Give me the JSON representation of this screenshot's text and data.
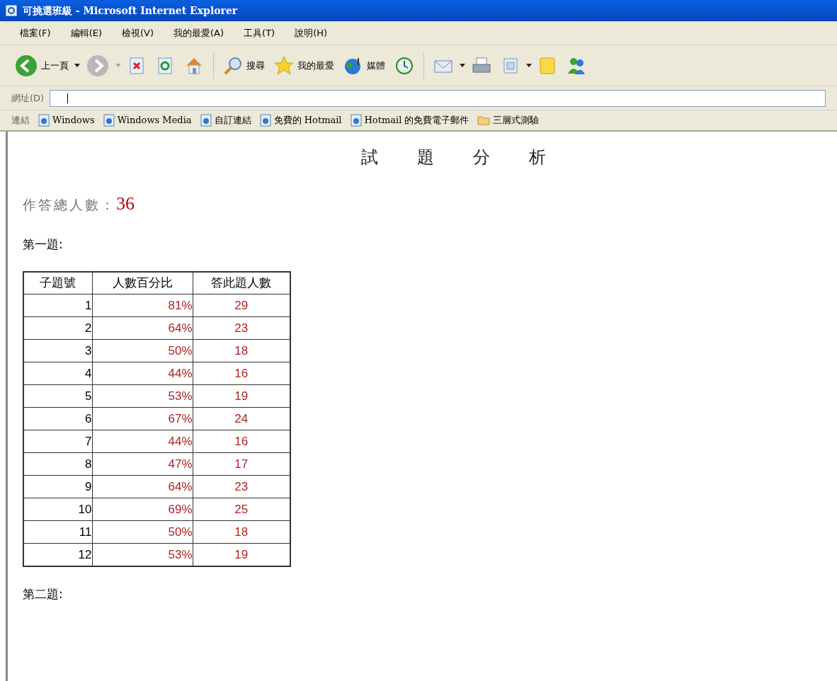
{
  "window": {
    "title": "可挑選班級 - Microsoft Internet Explorer"
  },
  "menu": [
    "檔案(F)",
    "編輯(E)",
    "檢視(V)",
    "我的最愛(A)",
    "工具(T)",
    "說明(H)"
  ],
  "toolbar": [
    {
      "kind": "back",
      "label": "上一頁",
      "dropdown": true,
      "disabled": false
    },
    {
      "kind": "forward",
      "dropdown": true,
      "disabled": true
    },
    {
      "kind": "stop"
    },
    {
      "kind": "refresh"
    },
    {
      "kind": "home"
    },
    {
      "kind": "separator"
    },
    {
      "kind": "search",
      "label": "搜尋"
    },
    {
      "kind": "favorites",
      "label": "我的最愛"
    },
    {
      "kind": "media",
      "label": "媒體"
    },
    {
      "kind": "history"
    },
    {
      "kind": "separator"
    },
    {
      "kind": "mail",
      "dropdown": true
    },
    {
      "kind": "print"
    },
    {
      "kind": "edit",
      "dropdown": true
    },
    {
      "kind": "note"
    },
    {
      "kind": "messenger"
    }
  ],
  "address": {
    "label": "網址(D)"
  },
  "links": {
    "label": "連結",
    "items": [
      {
        "kind": "page",
        "label": "Windows"
      },
      {
        "kind": "page",
        "label": "Windows Media"
      },
      {
        "kind": "page",
        "label": "自訂連結"
      },
      {
        "kind": "page",
        "label": "免費的 Hotmail"
      },
      {
        "kind": "page",
        "label": "Hotmail 的免費電子郵件"
      },
      {
        "kind": "folder",
        "label": "三層式測驗"
      }
    ]
  },
  "page": {
    "heading": "試題分析",
    "total_label": "作答總人數：",
    "total_value": "36",
    "sections": [
      {
        "title": "第一題:",
        "table": {
          "columns": [
            "子題號",
            "人數百分比",
            "答此題人數"
          ],
          "rows": [
            [
              "1",
              "81%",
              "29"
            ],
            [
              "2",
              "64%",
              "23"
            ],
            [
              "3",
              "50%",
              "18"
            ],
            [
              "4",
              "44%",
              "16"
            ],
            [
              "5",
              "53%",
              "19"
            ],
            [
              "6",
              "67%",
              "24"
            ],
            [
              "7",
              "44%",
              "16"
            ],
            [
              "8",
              "47%",
              "17"
            ],
            [
              "9",
              "64%",
              "23"
            ],
            [
              "10",
              "69%",
              "25"
            ],
            [
              "11",
              "50%",
              "18"
            ],
            [
              "12",
              "53%",
              "19"
            ]
          ]
        }
      },
      {
        "title": "第二題:"
      }
    ]
  }
}
